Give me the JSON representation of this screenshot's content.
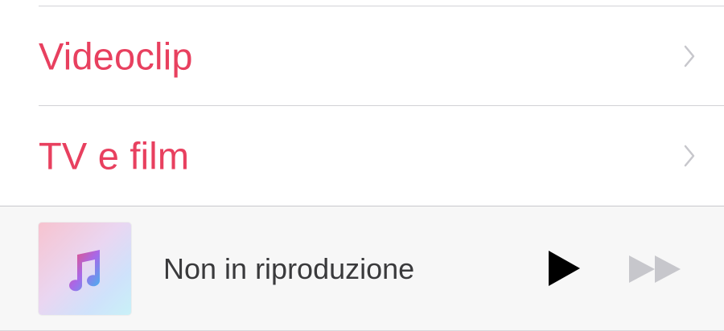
{
  "library_menu": {
    "items": [
      {
        "label": "Videoclip",
        "icon": "chevron-right-icon"
      },
      {
        "label": "TV e film",
        "icon": "chevron-right-icon"
      }
    ]
  },
  "mini_player": {
    "status": "Non in riproduzione",
    "artwork_icon": "music-note-icon",
    "controls": {
      "play_icon": "play-icon",
      "forward_icon": "fast-forward-icon"
    }
  },
  "colors": {
    "accent": "#e8405f",
    "divider": "#d2d2d6",
    "status_text": "#3a3a3c",
    "play": "#000000",
    "forward_disabled": "#c7c7cc"
  }
}
